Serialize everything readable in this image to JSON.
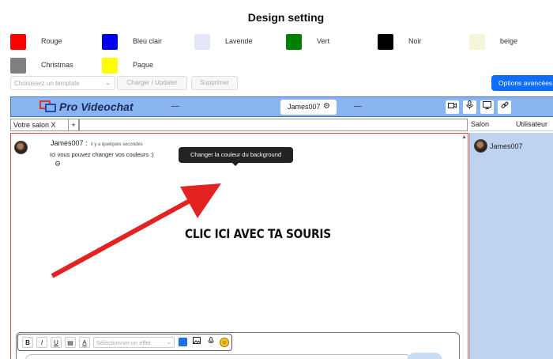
{
  "page": {
    "title": "Design setting"
  },
  "colors": [
    {
      "label": "Rouge",
      "hex": "#ff0000"
    },
    {
      "label": "Bleu clair",
      "hex": "#0000ee"
    },
    {
      "label": "Lavende",
      "hex": "#e6e6fa"
    },
    {
      "label": "Vert",
      "hex": "#008000"
    },
    {
      "label": "Noir",
      "hex": "#000000"
    },
    {
      "label": "beige",
      "hex": "#f5f5dc"
    },
    {
      "label": "Christmas",
      "hex": "#808080"
    },
    {
      "label": "Paque",
      "hex": "#ffff00"
    }
  ],
  "template": {
    "placeholder": "Choisissez un template",
    "load_label": "Charger / Updater",
    "delete_label": "Supprimer",
    "advanced_label": "Options avancées"
  },
  "topbar": {
    "brand": "Pro Videochat",
    "dash_left": "—",
    "dash_right": "—",
    "current_user": "James007",
    "bg_color": "#8ab4f0"
  },
  "rooms": {
    "active_tab": "Votre salon X",
    "add_label": "+"
  },
  "sidebar": {
    "col_room": "Salon",
    "col_user": "Utilisateur",
    "users": [
      "James007"
    ]
  },
  "chat": {
    "messages": [
      {
        "author": "James007 :",
        "time": "il y a quelques secondes",
        "text": "Ici vous pouvez changer vos couleurs :)"
      }
    ]
  },
  "tooltip": "Changer la couleur du background",
  "annotation": "CLIC ICI AVEC TA SOURIS",
  "editor": {
    "bold": "B",
    "italic": "I",
    "underline": "U",
    "effect_placeholder": "Sélectionner un effet",
    "accent_color": "#1e6fe8"
  }
}
